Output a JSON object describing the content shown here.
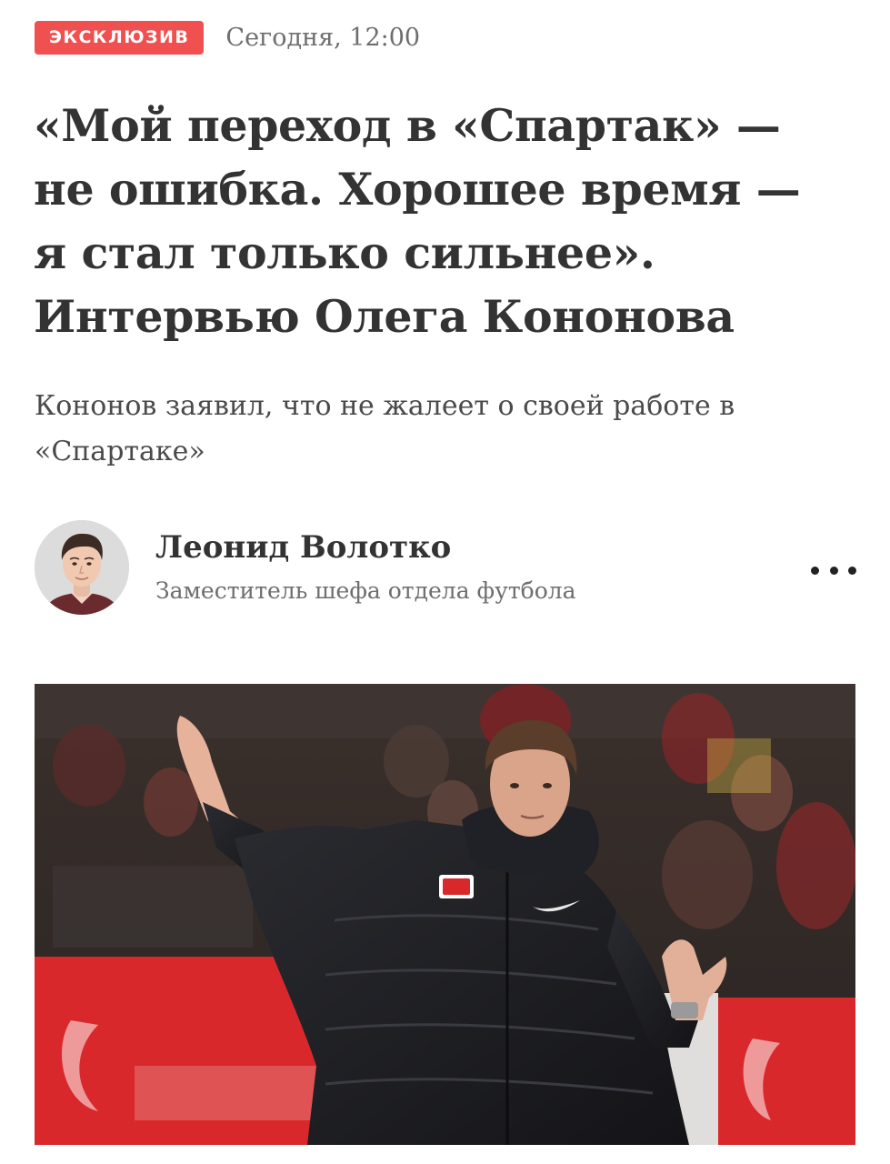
{
  "article": {
    "badge": "ЭКСКЛЮЗИВ",
    "badge_color": "#f0504f",
    "date": "Сегодня, 12:00",
    "headline_lines": [
      "«Мой переход в «Спартак» —",
      "не ошибка. Хорошее время —",
      "я стал только сильнее».",
      "Интервью Олега Кононова"
    ],
    "lead_lines": [
      "Кононов заявил, что не жалеет о своей работе в",
      "«Спартаке»"
    ]
  },
  "author": {
    "name": "Леонид Волотко",
    "role": "Заместитель шефа отдела футбола",
    "avatar_icon": "author-avatar-photo",
    "more_icon": "more-dots-icon"
  },
  "photo": {
    "description_icon": "hero-photo",
    "ad_board_color": "#d8282c"
  }
}
